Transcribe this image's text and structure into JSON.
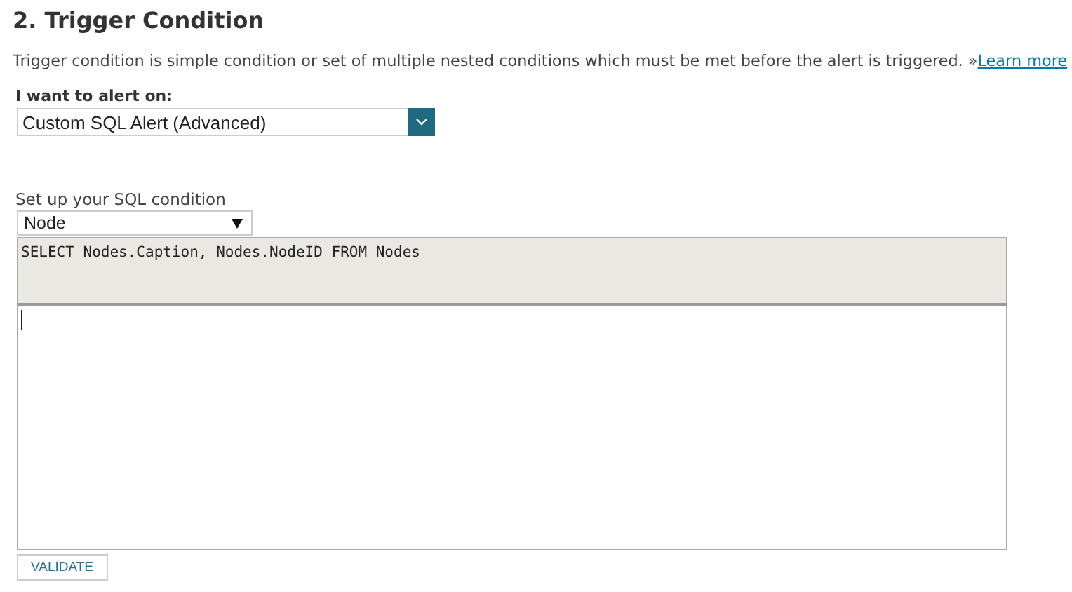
{
  "heading": "2. Trigger Condition",
  "description": {
    "text": "Trigger condition is simple condition or set of multiple nested conditions which must be met before the alert is triggered. »",
    "link": "Learn more"
  },
  "alert_on": {
    "label": "I want to alert on:",
    "value": "Custom SQL Alert (Advanced)"
  },
  "sql_condition": {
    "label": "Set up your SQL condition",
    "object_type": "Node",
    "query_prefix": "SELECT Nodes.Caption, Nodes.NodeID FROM Nodes",
    "editor": {
      "focused": true
    }
  },
  "buttons": [
    {
      "label": "VALIDATE"
    }
  ]
}
